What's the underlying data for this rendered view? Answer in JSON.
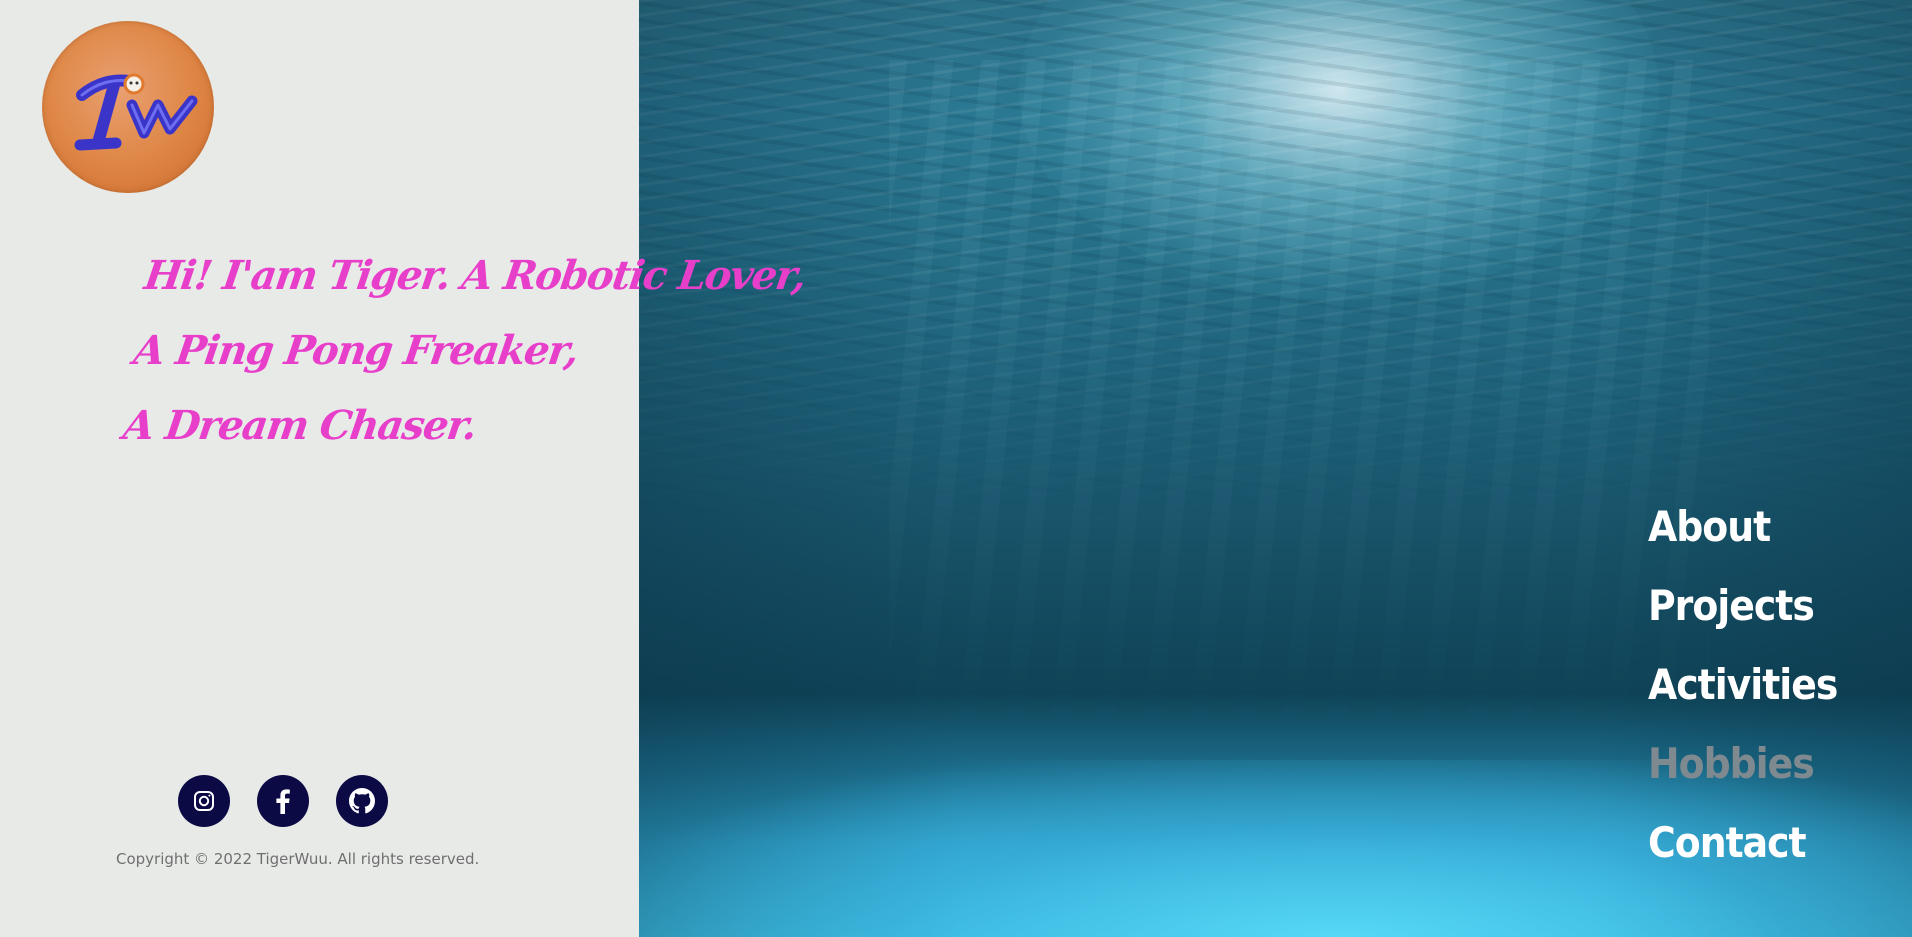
{
  "greeting": {
    "lines": [
      "Hi! I'am Tiger. A Robotic Lover,",
      "A Ping Pong Freaker,",
      "A Dream Chaser."
    ],
    "color": "#e83fcb"
  },
  "logo": {
    "icon": "tw-monogram-logo",
    "colors": {
      "disc": "#de8544",
      "letters": "#3b34c9"
    }
  },
  "socials": [
    {
      "icon": "instagram-icon"
    },
    {
      "icon": "facebook-icon"
    },
    {
      "icon": "github-icon"
    }
  ],
  "footer": {
    "copyright": "Copyright © 2022 TigerWuu. All rights reserved."
  },
  "nav": {
    "items": [
      {
        "label": "About",
        "active": false
      },
      {
        "label": "Projects",
        "active": false
      },
      {
        "label": "Activities",
        "active": false
      },
      {
        "label": "Hobbies",
        "active": true
      },
      {
        "label": "Contact",
        "active": false
      }
    ]
  },
  "colors": {
    "left_bg": "#e8eae8",
    "social_btn": "#0c0a45",
    "nav_text": "#ffffff",
    "nav_muted": "#7f8a90"
  }
}
